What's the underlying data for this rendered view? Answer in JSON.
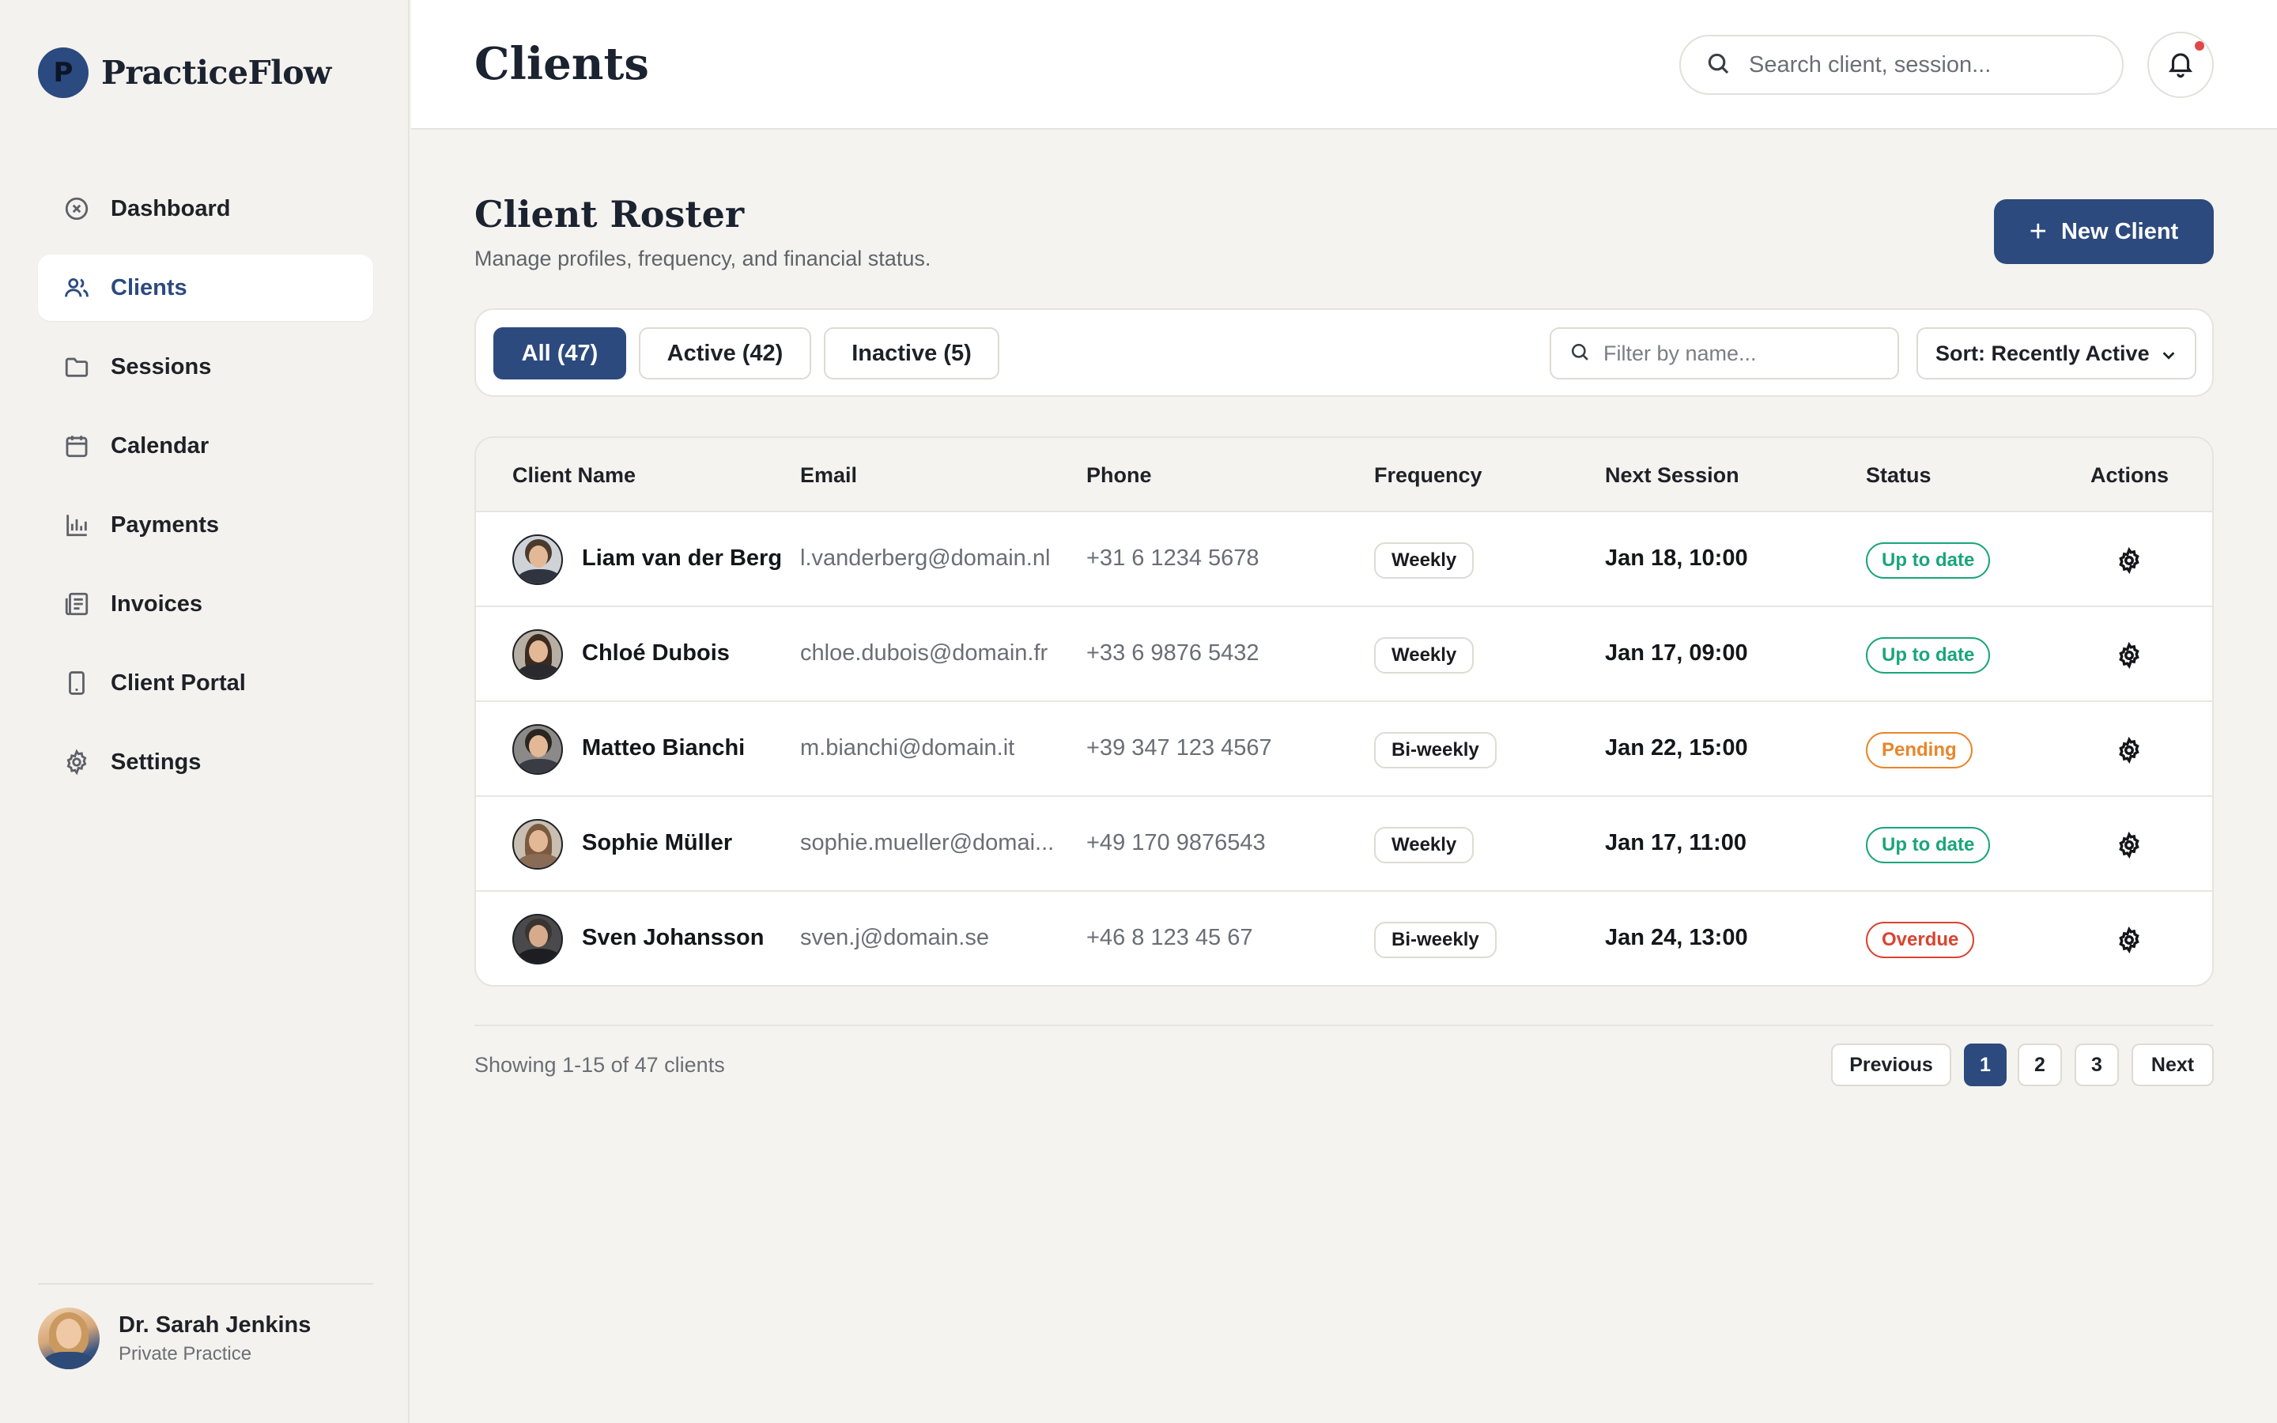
{
  "brand": {
    "logo_letter": "P",
    "name": "PracticeFlow"
  },
  "sidebar": {
    "items": [
      {
        "label": "Dashboard",
        "icon": "circle-x-icon"
      },
      {
        "label": "Clients",
        "icon": "users-icon",
        "active": true
      },
      {
        "label": "Sessions",
        "icon": "folder-icon"
      },
      {
        "label": "Calendar",
        "icon": "calendar-icon"
      },
      {
        "label": "Payments",
        "icon": "bar-chart-icon"
      },
      {
        "label": "Invoices",
        "icon": "invoice-icon"
      },
      {
        "label": "Client Portal",
        "icon": "phone-icon"
      },
      {
        "label": "Settings",
        "icon": "gear-icon"
      }
    ],
    "profile": {
      "name": "Dr. Sarah Jenkins",
      "role": "Private Practice"
    }
  },
  "header": {
    "title": "Clients",
    "search_placeholder": "Search client, session...",
    "notification_dot_color": "#e04848"
  },
  "main": {
    "section_title": "Client Roster",
    "section_subtitle": "Manage profiles, frequency, and financial status.",
    "new_client_label": "New Client",
    "filters": {
      "tabs": [
        {
          "label": "All (47)",
          "active": true
        },
        {
          "label": "Active (42)",
          "active": false
        },
        {
          "label": "Inactive (5)",
          "active": false
        }
      ],
      "filter_placeholder": "Filter by name...",
      "sort_label": "Sort: Recently Active"
    },
    "table": {
      "columns": [
        "Client Name",
        "Email",
        "Phone",
        "Frequency",
        "Next Session",
        "Status",
        "Actions"
      ],
      "rows": [
        {
          "name": "Liam van der Berg",
          "email": "l.vanderberg@domain.nl",
          "phone": "+31 6 1234 5678",
          "frequency": "Weekly",
          "next_session": "Jan 18, 10:00",
          "status": "Up to date"
        },
        {
          "name": "Chloé Dubois",
          "email": "chloe.dubois@domain.fr",
          "phone": "+33 6 9876 5432",
          "frequency": "Weekly",
          "next_session": "Jan 17, 09:00",
          "status": "Up to date"
        },
        {
          "name": "Matteo Bianchi",
          "email": "m.bianchi@domain.it",
          "phone": "+39 347 123 4567",
          "frequency": "Bi-weekly",
          "next_session": "Jan 22, 15:00",
          "status": "Pending"
        },
        {
          "name": "Sophie Müller",
          "email": "sophie.mueller@domai...",
          "phone": "+49 170 9876543",
          "frequency": "Weekly",
          "next_session": "Jan 17, 11:00",
          "status": "Up to date"
        },
        {
          "name": "Sven Johansson",
          "email": "sven.j@domain.se",
          "phone": "+46 8 123 45 67",
          "frequency": "Bi-weekly",
          "next_session": "Jan 24, 13:00",
          "status": "Overdue"
        }
      ]
    },
    "pagination": {
      "summary": "Showing 1-15 of 47 clients",
      "previous_label": "Previous",
      "pages": [
        "1",
        "2",
        "3"
      ],
      "current_page": "1",
      "next_label": "Next"
    }
  },
  "colors": {
    "accent": "#2c4a7e",
    "status_up_to_date": "#1aa57a",
    "status_pending": "#e8862a",
    "status_overdue": "#d9442f"
  }
}
